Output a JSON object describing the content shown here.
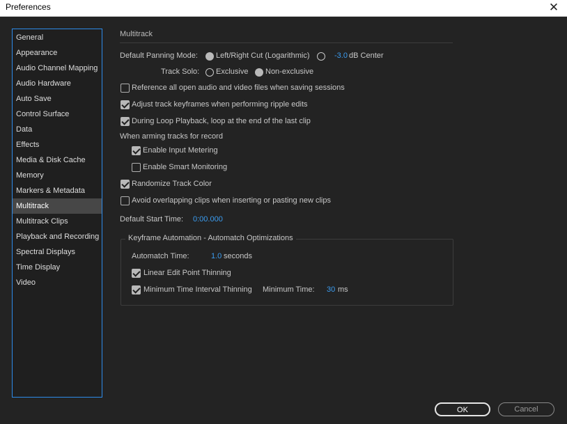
{
  "window": {
    "title": "Preferences",
    "close_glyph": "✕"
  },
  "sidebar": {
    "items": [
      {
        "label": "General"
      },
      {
        "label": "Appearance"
      },
      {
        "label": "Audio Channel Mapping"
      },
      {
        "label": "Audio Hardware"
      },
      {
        "label": "Auto Save"
      },
      {
        "label": "Control Surface"
      },
      {
        "label": "Data"
      },
      {
        "label": "Effects"
      },
      {
        "label": "Media & Disk Cache"
      },
      {
        "label": "Memory"
      },
      {
        "label": "Markers & Metadata"
      },
      {
        "label": "Multitrack"
      },
      {
        "label": "Multitrack Clips"
      },
      {
        "label": "Playback and Recording"
      },
      {
        "label": "Spectral Displays"
      },
      {
        "label": "Time Display"
      },
      {
        "label": "Video"
      }
    ],
    "selected": "Multitrack"
  },
  "main": {
    "section_title": "Multitrack",
    "panning": {
      "label": "Default Panning Mode:",
      "option1": "Left/Right Cut (Logarithmic)",
      "option2_value": "-3.0",
      "option2_suffix": "dB Center",
      "selected": "option1"
    },
    "track_solo": {
      "label": "Track Solo:",
      "option1": "Exclusive",
      "option2": "Non-exclusive",
      "selected": "option2"
    },
    "reference_files": {
      "label": "Reference all open audio and video files when saving sessions",
      "checked": false
    },
    "adjust_keyframes": {
      "label": "Adjust track keyframes when performing ripple edits",
      "checked": true
    },
    "loop_playback": {
      "label": "During Loop Playback, loop at the end of the last clip",
      "checked": true
    },
    "arming_label": "When arming tracks for record",
    "input_metering": {
      "label": "Enable Input Metering",
      "checked": true
    },
    "smart_monitoring": {
      "label": "Enable Smart Monitoring",
      "checked": false
    },
    "randomize_color": {
      "label": "Randomize Track Color",
      "checked": true
    },
    "avoid_overlap": {
      "label": "Avoid overlapping clips when inserting or pasting new clips",
      "checked": false
    },
    "start_time": {
      "label": "Default Start Time:",
      "value": "0:00.000"
    },
    "keyframe": {
      "title": "Keyframe Automation - Automatch Optimizations",
      "automatch_label": "Automatch Time:",
      "automatch_value": "1.0",
      "automatch_unit": "seconds",
      "linear_thinning": {
        "label": "Linear Edit Point Thinning",
        "checked": true
      },
      "min_interval": {
        "label": "Minimum Time Interval Thinning",
        "checked": true
      },
      "min_time_label": "Minimum Time:",
      "min_time_value": "30",
      "min_time_unit": "ms"
    }
  },
  "buttons": {
    "ok": "OK",
    "cancel": "Cancel"
  },
  "colors": {
    "accent": "#2d8ceb",
    "value_blue": "#3b9cf0",
    "background": "#232323"
  }
}
